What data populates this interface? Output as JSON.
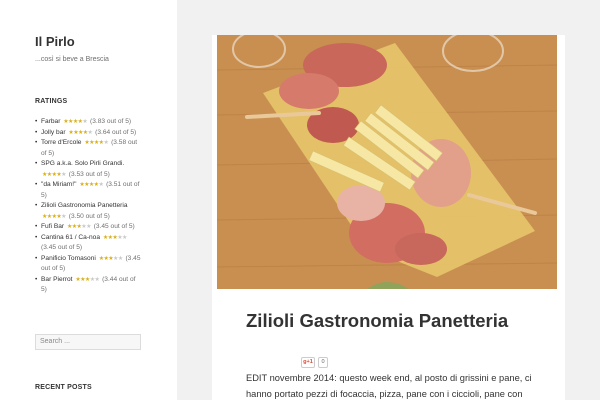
{
  "site": {
    "title": "Il Pirlo",
    "description": "...così si beve a Brescia"
  },
  "ratings": {
    "title": "RATINGS",
    "items": [
      {
        "name": "Farbar",
        "stars": 4,
        "score": "(3.83 out of 5)"
      },
      {
        "name": "Jolly bar",
        "stars": 4,
        "score": "(3.64 out of 5)"
      },
      {
        "name": "Torre d'Ercole",
        "stars": 4,
        "score": "(3.58 out of 5)"
      },
      {
        "name": "SPG a.k.a. Solo Pirli Grandi.",
        "stars": 4,
        "score": "(3.53 out of 5)"
      },
      {
        "name": "\"da Miriam!\"",
        "stars": 4,
        "score": "(3.51 out of 5)"
      },
      {
        "name": "Zilioli Gastronomia Panetteria",
        "stars": 4,
        "score": "(3.50 out of 5)"
      },
      {
        "name": "Fufi Bar",
        "stars": 3,
        "score": "(3.45 out of 5)"
      },
      {
        "name": "Cantina 61 / Ca-noa",
        "stars": 3,
        "score": "(3.45 out of 5)"
      },
      {
        "name": "Panificio Tomasoni",
        "stars": 3,
        "score": "(3.45 out of 5)"
      },
      {
        "name": "Bar Pierrot",
        "stars": 3,
        "score": "(3.44 out of 5)"
      }
    ]
  },
  "search": {
    "placeholder": "Search ..."
  },
  "recent_posts": {
    "title": "RECENT POSTS"
  },
  "post": {
    "title": "Zilioli Gastronomia Panetteria",
    "share": {
      "gplus_label": "g+1",
      "count": "0"
    },
    "body": "EDIT novembre 2014: questo week end, al posto di grissini e pane, ci hanno portato pezzi di focaccia, pizza, pane con i ciccioli, pane con"
  },
  "colors": {
    "star_on": "#d9b01c",
    "star_off": "#c9c9c9",
    "board": "#e6c46a",
    "table": "#c98f51"
  }
}
